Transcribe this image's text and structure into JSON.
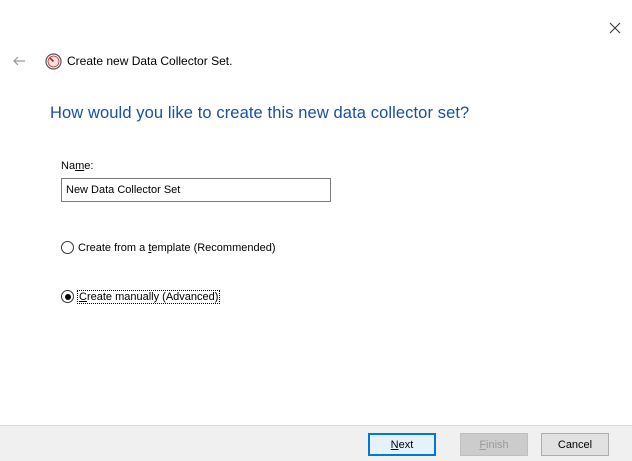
{
  "wizard": {
    "title": "Create new Data Collector Set.",
    "heading": "How would you like to create this new data collector set?"
  },
  "form": {
    "name_label": {
      "pre": "Na",
      "accel": "m",
      "post": "e:"
    },
    "name_value": "New Data Collector Set",
    "options": [
      {
        "pre": "Create from a ",
        "accel": "t",
        "post": "emplate (Recommended)",
        "checked": false
      },
      {
        "pre": "",
        "accel": "C",
        "post": "reate manually (Advanced)",
        "checked": true
      }
    ]
  },
  "buttons": {
    "next": {
      "pre": "",
      "accel": "N",
      "post": "ext"
    },
    "finish": {
      "pre": "",
      "accel": "F",
      "post": "inish"
    },
    "cancel": "Cancel"
  },
  "icons": {
    "close": "close-icon",
    "back": "back-arrow-icon",
    "app": "performance-monitor-icon"
  },
  "colors": {
    "heading": "#1a4fa3",
    "focus": "#0078d7",
    "footer": "#f0f0f0"
  }
}
